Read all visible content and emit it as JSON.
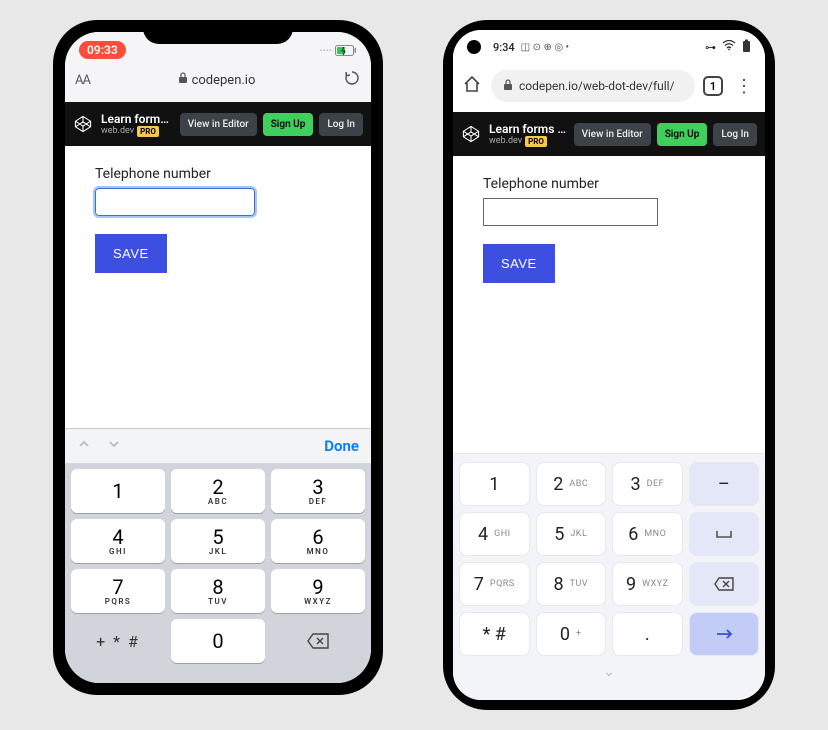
{
  "iphone": {
    "status": {
      "time": "09:33"
    },
    "browser": {
      "aa": "AA",
      "domain": "codepen.io"
    },
    "codepen": {
      "title": "Learn forms – virt...",
      "subtitle": "web.dev",
      "pro": "PRO",
      "view": "View in Editor",
      "signup": "Sign Up",
      "login": "Log In"
    },
    "form": {
      "label": "Telephone number",
      "value": "",
      "save": "SAVE"
    },
    "kb_toolbar": {
      "done": "Done"
    },
    "keys": [
      {
        "n": "1",
        "l": ""
      },
      {
        "n": "2",
        "l": "ABC"
      },
      {
        "n": "3",
        "l": "DEF"
      },
      {
        "n": "4",
        "l": "GHI"
      },
      {
        "n": "5",
        "l": "JKL"
      },
      {
        "n": "6",
        "l": "MNO"
      },
      {
        "n": "7",
        "l": "PQRS"
      },
      {
        "n": "8",
        "l": "TUV"
      },
      {
        "n": "9",
        "l": "WXYZ"
      }
    ],
    "sym_key": "+ * #",
    "zero_key": "0"
  },
  "android": {
    "status": {
      "time": "9:34"
    },
    "url": {
      "text": "codepen.io/web-dot-dev/full/",
      "tabcount": "1"
    },
    "codepen": {
      "title": "Learn forms – virt...",
      "subtitle": "web.dev",
      "pro": "PRO",
      "view": "View in Editor",
      "signup": "Sign Up",
      "login": "Log In"
    },
    "form": {
      "label": "Telephone number",
      "value": "",
      "save": "SAVE"
    },
    "keys_row1": [
      {
        "n": "1",
        "l": ""
      },
      {
        "n": "2",
        "l": "ABC"
      },
      {
        "n": "3",
        "l": "DEF"
      }
    ],
    "keys_row2": [
      {
        "n": "4",
        "l": "GHI"
      },
      {
        "n": "5",
        "l": "JKL"
      },
      {
        "n": "6",
        "l": "MNO"
      }
    ],
    "keys_row3": [
      {
        "n": "7",
        "l": "PQRS"
      },
      {
        "n": "8",
        "l": "TUV"
      },
      {
        "n": "9",
        "l": "WXYZ"
      }
    ],
    "keys_row4": [
      {
        "n": "* #",
        "l": ""
      },
      {
        "n": "0",
        "l": "+"
      },
      {
        "n": ".",
        "l": ""
      }
    ],
    "side_dash": "–",
    "side_space": "⎵"
  }
}
